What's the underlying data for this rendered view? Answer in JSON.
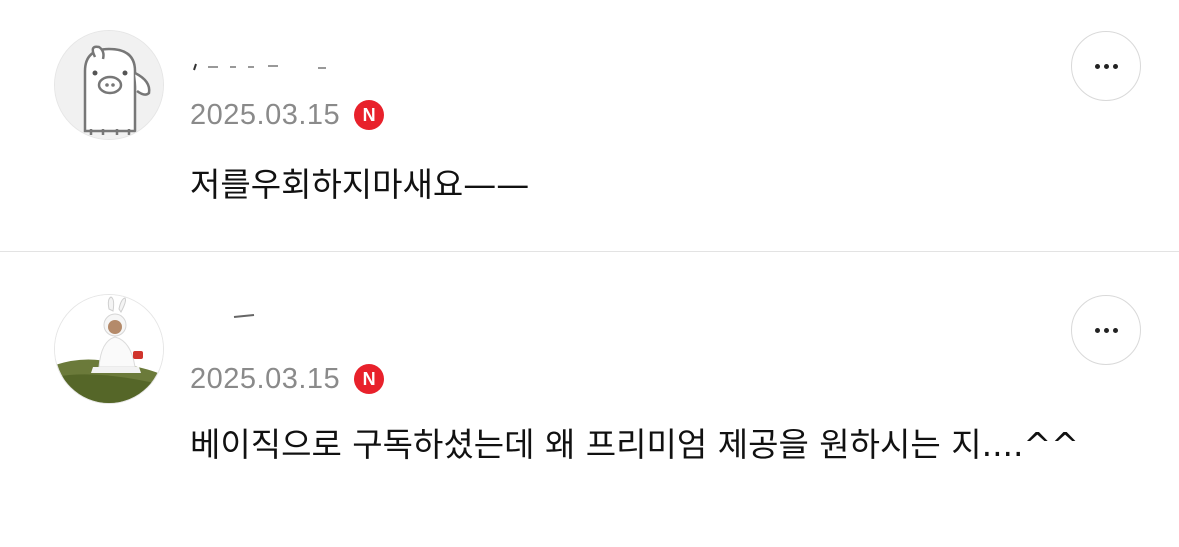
{
  "comments": [
    {
      "date": "2025.03.15",
      "badge": "N",
      "text": "저를우회하지마새요——",
      "more_icon": "ellipsis-icon"
    },
    {
      "date": "2025.03.15",
      "badge": "N",
      "text": "베이직으로 구독하셨는데 왜 프리미엄 제공을 원하시는 지....^^",
      "more_icon": "ellipsis-icon"
    }
  ],
  "colors": {
    "badge": "#e8212b",
    "date": "#8a8a8a",
    "divider": "#e3e3e3"
  }
}
